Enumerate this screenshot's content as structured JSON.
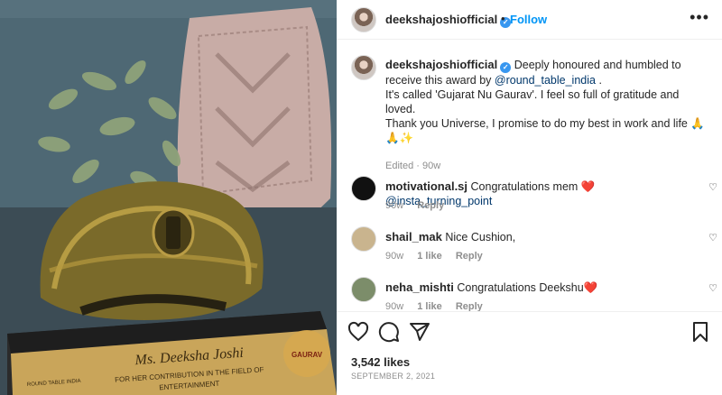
{
  "header": {
    "username": "deekshajoshiofficial",
    "separator": "•",
    "follow_label": "Follow",
    "more_icon": "more-horizontal-icon"
  },
  "caption": {
    "username": "deekshajoshiofficial",
    "line1_pre": "Deeply honoured and humbled to receive this award by ",
    "mention": "@round_table_india",
    "line1_post": " .",
    "line2": "It's called 'Gujarat Nu Gaurav'. I feel so full of gratitude and loved.",
    "line3": "Thank you Universe, I promise to do my best in work and life 🙏🙏✨",
    "meta": "Edited · 90w"
  },
  "comments": [
    {
      "username": "motivational.sj",
      "text": "Congratulations mem ❤️ ",
      "mention": "@insta_turning_point",
      "age": "90w",
      "likes": "",
      "reply": "Reply"
    },
    {
      "username": "shail_mak",
      "text": "Nice Cushion,",
      "mention": "",
      "age": "90w",
      "likes": "1 like",
      "reply": "Reply"
    },
    {
      "username": "neha_mishti",
      "text": "Congratulations Deekshu❤️",
      "mention": "",
      "age": "90w",
      "likes": "1 like",
      "reply": "Reply"
    }
  ],
  "actions": {
    "icons": [
      "heart-icon",
      "comment-icon",
      "share-icon",
      "bookmark-icon"
    ],
    "likes": "3,542 likes",
    "date": "SEPTEMBER 2, 2021"
  },
  "photo": {
    "plaque_line1": "Ms. Deeksha Joshi",
    "plaque_line2": "FOR HER CONTRIBUTION IN THE FIELD OF",
    "plaque_line3": "ENTERTAINMENT",
    "badge_text": "GAURAV",
    "org_text": "ROUND TABLE INDIA",
    "colors": {
      "turban": "#7a6a2a",
      "plaque": "#c9a55a",
      "cushion": "#c8aca6",
      "wall": "#4b6470"
    }
  }
}
